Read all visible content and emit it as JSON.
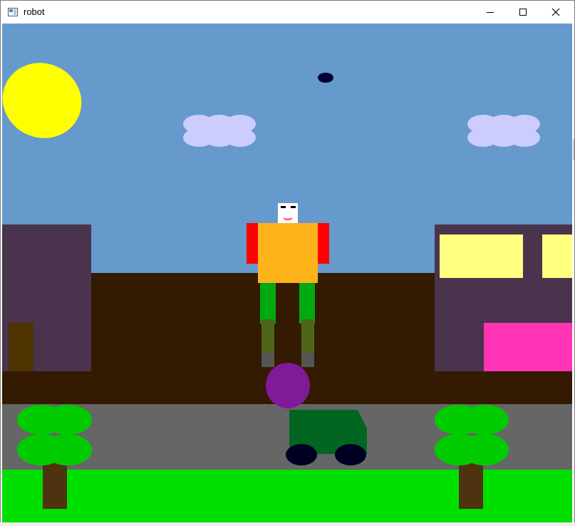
{
  "window": {
    "title": "robot",
    "controls": {
      "minimize_icon": "minimize-icon",
      "maximize_icon": "maximize-icon",
      "close_icon": "close-icon"
    }
  },
  "scene": {
    "colors": {
      "sky": "#6699cc",
      "sun": "#ffff00",
      "cloud": "#ccccff",
      "bird": "#000033",
      "building": "#4a334d",
      "building_window": "#ffff80",
      "building_pink_panel": "#ff33b3",
      "building_door": "#4d3300",
      "back_wall": "#331a00",
      "road": "#666666",
      "grass": "#00e000",
      "tree_leaves": "#00cc00",
      "tree_trunk": "#4d3310",
      "car_body": "#006622",
      "car_wheel": "#000022",
      "ball": "#801a99",
      "robot_head": "#ffffff",
      "robot_eye": "#000000",
      "robot_mouth": "#ff3366",
      "robot_body": "#ffb31a",
      "robot_arm": "#ff0000",
      "robot_thigh": "#00aa11",
      "robot_shin": "#4d6619",
      "robot_foot": "#555555"
    }
  }
}
